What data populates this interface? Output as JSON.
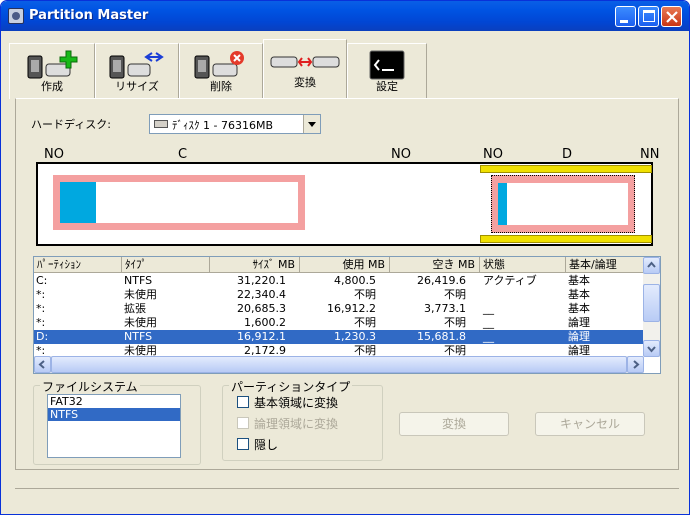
{
  "window": {
    "title": "Partition Master"
  },
  "toolbar": {
    "tabs": [
      {
        "label": "作成",
        "icon": "create-partition-icon"
      },
      {
        "label": "リサイズ",
        "icon": "resize-partition-icon"
      },
      {
        "label": "削除",
        "icon": "delete-partition-icon"
      },
      {
        "label": "変換",
        "icon": "convert-partition-icon"
      },
      {
        "label": "設定",
        "icon": "console-settings-icon"
      }
    ],
    "active_tab": "変換"
  },
  "hard_disk": {
    "label": "ハードディスク:",
    "selected": "ﾃﾞｨｽｸ 1 - 76316MB"
  },
  "disk_map": {
    "labels": [
      "NO",
      "C",
      "NO",
      "NO",
      "D",
      "NN"
    ],
    "colors": {
      "primary": "#f4a0a0",
      "used": "#00a8e0",
      "extended": "#f0e000"
    }
  },
  "partition_table": {
    "columns": [
      "ﾊﾟｰﾃｨｼｮﾝ",
      "ﾀｲﾌﾟ",
      "ｻｲｽﾞ MB",
      "使用 MB",
      "空き MB",
      "状態",
      "基本/論理"
    ],
    "rows": [
      [
        "C:",
        "NTFS",
        "31,220.1",
        "4,800.5",
        "26,419.6",
        "アクティブ",
        "基本"
      ],
      [
        "*:",
        "未使用",
        "22,340.4",
        "不明",
        "不明",
        "",
        "基本"
      ],
      [
        "*:",
        "拡張",
        "20,685.3",
        "16,912.2",
        "3,773.1",
        "__",
        "基本"
      ],
      [
        "*:",
        "未使用",
        "1,600.2",
        "不明",
        "不明",
        "__",
        "論理"
      ],
      [
        "D:",
        "NTFS",
        "16,912.1",
        "1,230.3",
        "15,681.8",
        "__",
        "論理"
      ],
      [
        "*:",
        "未使用",
        "2,172.9",
        "不明",
        "不明",
        "",
        "論理"
      ]
    ],
    "selected_row": 4
  },
  "filesystem": {
    "title": "ファイルシステム",
    "items": [
      "FAT32",
      "NTFS"
    ],
    "selected": "NTFS"
  },
  "partition_type": {
    "title": "パーティションタイプ",
    "options": [
      {
        "label": "基本領域に変換",
        "enabled": true,
        "checked": false
      },
      {
        "label": "論理領域に変換",
        "enabled": false,
        "checked": false
      },
      {
        "label": "隠し",
        "enabled": true,
        "checked": false
      }
    ]
  },
  "buttons": {
    "convert": "変換",
    "cancel": "キャンセル"
  }
}
